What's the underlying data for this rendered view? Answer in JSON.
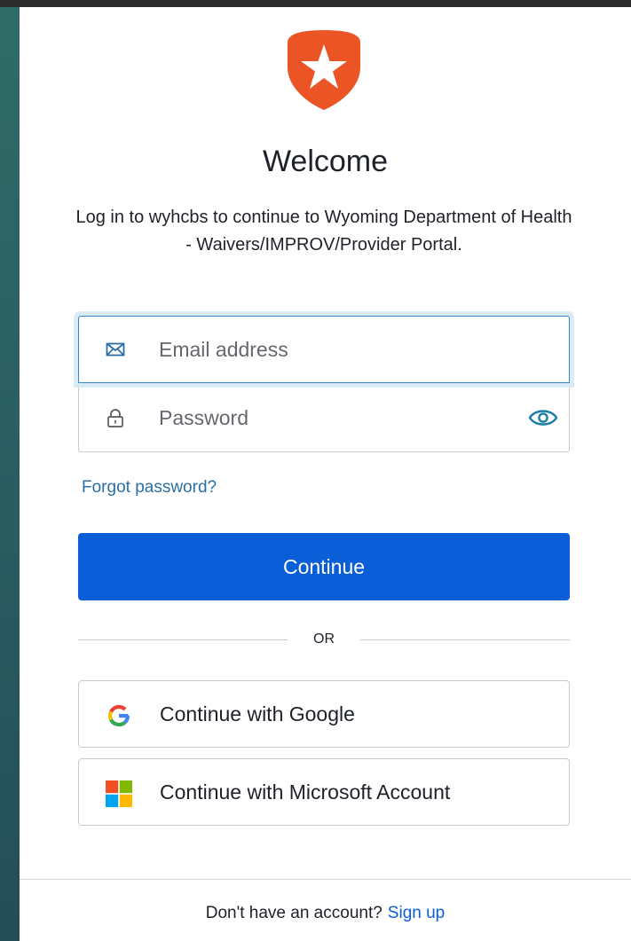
{
  "header": {
    "logo_icon": "auth0-star-shield-icon",
    "title": "Welcome",
    "description": "Log in to wyhcbs to continue to Wyoming Department of Health - Waivers/IMPROV/Provider Portal."
  },
  "form": {
    "email": {
      "placeholder": "Email address",
      "value": "",
      "icon": "envelope-icon"
    },
    "password": {
      "placeholder": "Password",
      "value": "",
      "icon": "lock-icon",
      "toggle_icon": "eye-icon"
    },
    "forgot_password_label": "Forgot password?",
    "continue_label": "Continue"
  },
  "divider": {
    "label": "OR"
  },
  "social": {
    "google_label": "Continue with Google",
    "microsoft_label": "Continue with Microsoft Account"
  },
  "footer": {
    "prompt": "Don't have an account?",
    "signup_label": "Sign up"
  },
  "colors": {
    "primary": "#0a5fd8",
    "logo": "#eb5424",
    "link": "#2b6ea6",
    "focus_border": "#3a87c8",
    "background": "#2b5f62"
  }
}
